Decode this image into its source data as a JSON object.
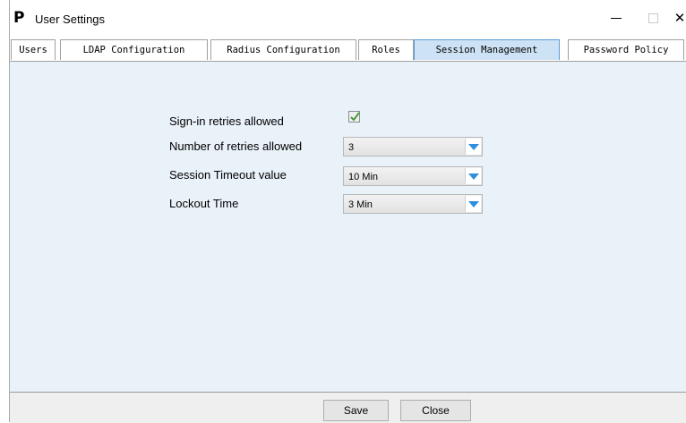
{
  "window": {
    "title": "User Settings",
    "logo_text": "P",
    "controls": {
      "close": "✕"
    }
  },
  "tabs": [
    {
      "label": "Users"
    },
    {
      "label": "LDAP Configuration"
    },
    {
      "label": "Radius Configuration"
    },
    {
      "label": "Roles"
    },
    {
      "label": "Session Management",
      "active": true
    },
    {
      "label": "Password Policy"
    }
  ],
  "session": {
    "signin_retries_label": "Sign-in retries allowed",
    "signin_retries_checked": true,
    "retries_label": "Number of retries allowed",
    "retries_value": "3",
    "timeout_label": "Session Timeout value",
    "timeout_value": "10 Min",
    "lockout_label": "Lockout Time",
    "lockout_value": "3 Min"
  },
  "footer": {
    "save_label": "Save",
    "close_label": "Close"
  },
  "colors": {
    "content_bg": "#e9f1f9",
    "active_tab_bg": "#cde2f4",
    "dropdown_arrow": "#2f8fdc"
  }
}
